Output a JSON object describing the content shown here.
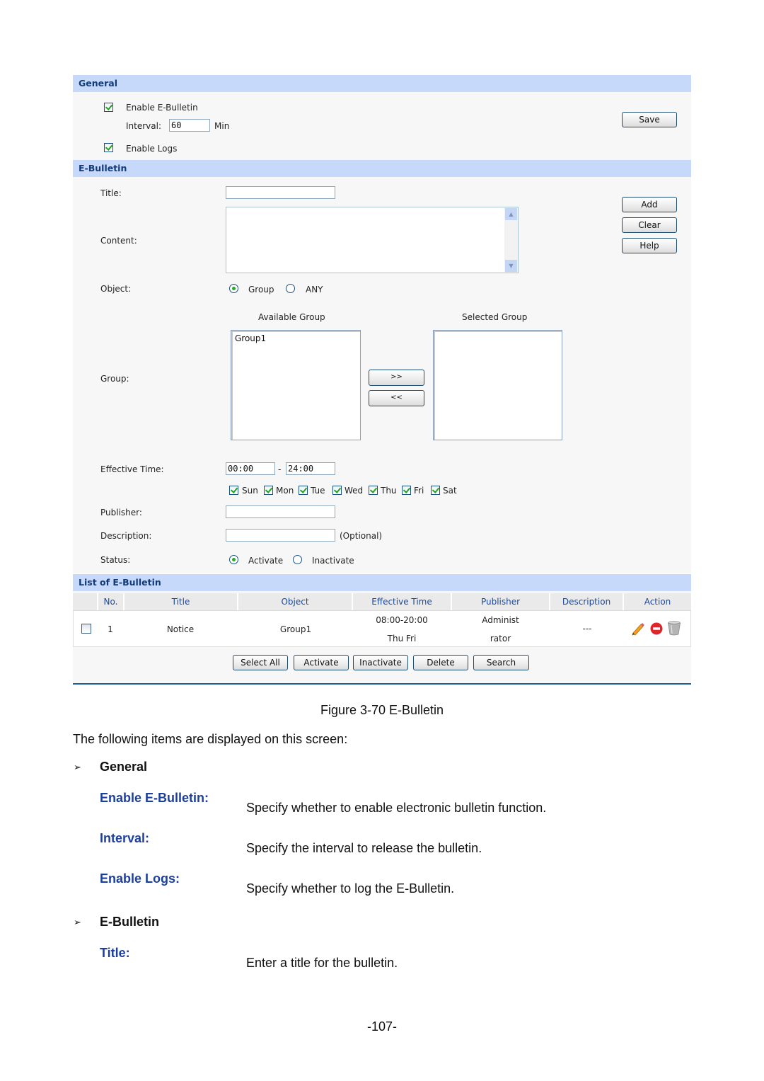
{
  "screenshot": {
    "general": {
      "header": "General",
      "enable_ebulletin": {
        "label": "Enable E-Bulletin",
        "checked": true
      },
      "interval": {
        "label": "Interval:",
        "value": "60",
        "unit": "Min"
      },
      "enable_logs": {
        "label": "Enable Logs",
        "checked": true
      },
      "save_label": "Save"
    },
    "ebulletin": {
      "header": "E-Bulletin",
      "title_label": "Title:",
      "title_value": "",
      "content_label": "Content:",
      "content_value": "",
      "object_label": "Object:",
      "object_options": [
        {
          "label": "Group",
          "selected": true
        },
        {
          "label": "ANY",
          "selected": false
        }
      ],
      "available_group_label": "Available Group",
      "selected_group_label": "Selected Group",
      "available_groups": [
        "Group1"
      ],
      "selected_groups": [],
      "group_label": "Group:",
      "move_right_label": ">>",
      "move_left_label": "<<",
      "effective_time_label": "Effective Time:",
      "time_start": "00:00",
      "time_sep": "-",
      "time_end": "24:00",
      "days": [
        {
          "label": "Sun",
          "checked": true
        },
        {
          "label": "Mon",
          "checked": true
        },
        {
          "label": "Tue",
          "checked": true
        },
        {
          "label": "Wed",
          "checked": true
        },
        {
          "label": "Thu",
          "checked": true
        },
        {
          "label": "Fri",
          "checked": true
        },
        {
          "label": "Sat",
          "checked": true
        }
      ],
      "publisher_label": "Publisher:",
      "publisher_value": "",
      "description_label": "Description:",
      "description_value": "",
      "description_hint": "(Optional)",
      "status_label": "Status:",
      "status_options": [
        {
          "label": "Activate",
          "selected": true
        },
        {
          "label": "Inactivate",
          "selected": false
        }
      ],
      "add_label": "Add",
      "clear_label": "Clear",
      "help_label": "Help"
    },
    "list": {
      "header": "List of E-Bulletin",
      "columns": [
        "",
        "No.",
        "Title",
        "Object",
        "Effective Time",
        "Publisher",
        "Description",
        "Action"
      ],
      "rows": [
        {
          "checked": false,
          "no": "1",
          "title": "Notice",
          "object": "Group1",
          "time_line1": "08:00-20:00",
          "time_line2": "Thu Fri",
          "publisher_line1": "Administ",
          "publisher_line2": "rator",
          "description": "---",
          "actions": [
            "edit-icon",
            "disable-icon",
            "delete-icon"
          ]
        }
      ],
      "buttons": [
        "Select All",
        "Activate",
        "Inactivate",
        "Delete",
        "Search"
      ]
    }
  },
  "document": {
    "figure_caption": "Figure 3-70 E-Bulletin",
    "intro": "The following items are displayed on this screen:",
    "sections": [
      {
        "heading": "General",
        "items": [
          {
            "label": "Enable E-Bulletin:",
            "desc": "Specify whether to enable electronic bulletin function."
          },
          {
            "label": "Interval:",
            "desc": "Specify the interval to release the bulletin."
          },
          {
            "label": "Enable Logs:",
            "desc": "Specify whether to log the E-Bulletin."
          }
        ]
      },
      {
        "heading": "E-Bulletin",
        "items": [
          {
            "label": "Title:",
            "desc": "Enter a title for the bulletin."
          }
        ]
      }
    ],
    "bullet_glyph": "➢",
    "page_number": "-107-"
  }
}
